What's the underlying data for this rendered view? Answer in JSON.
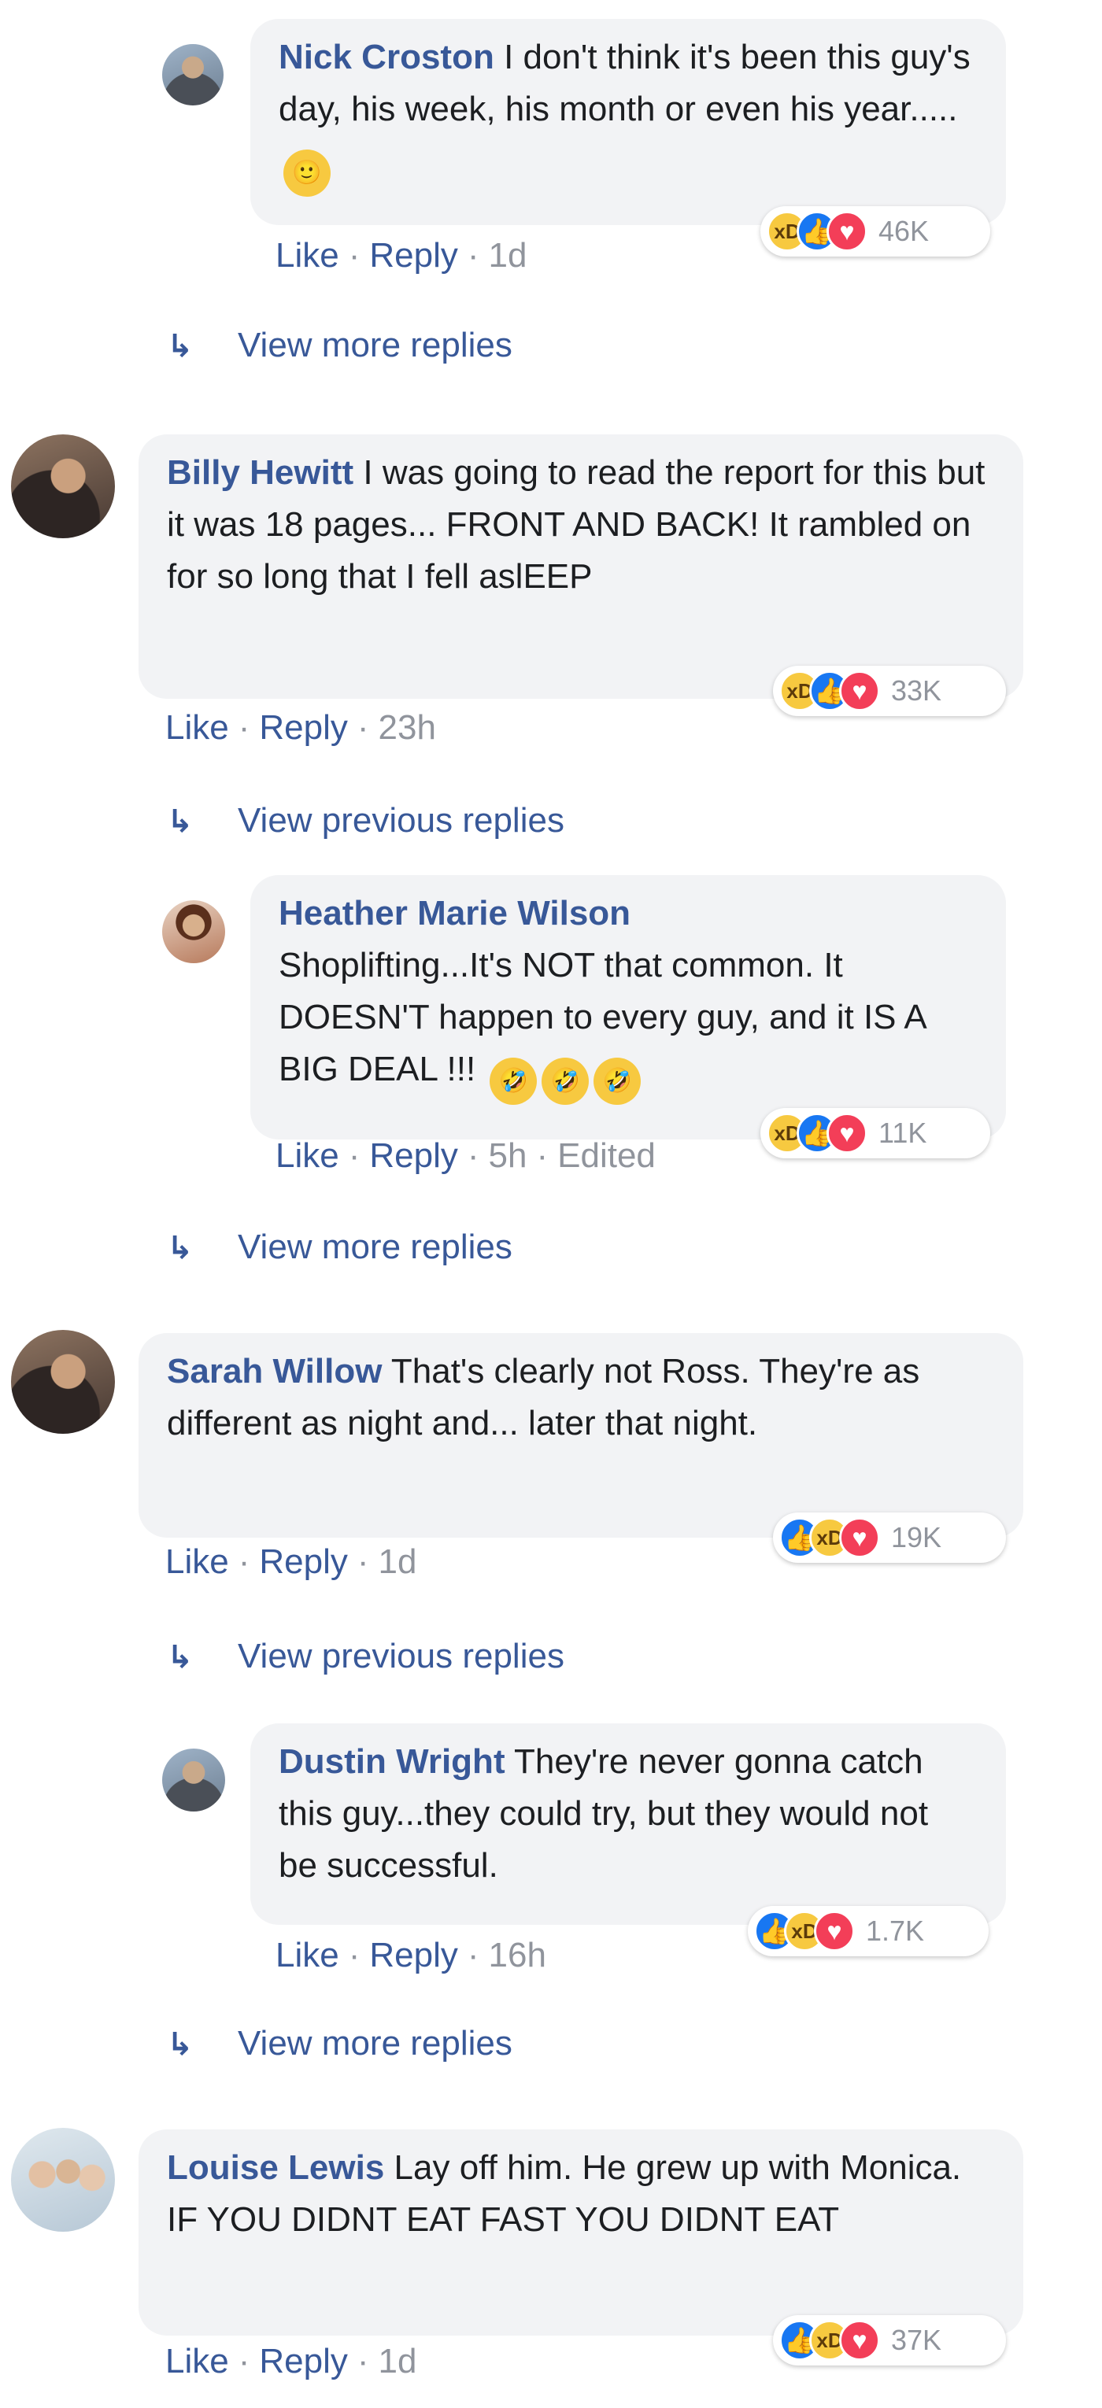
{
  "comments": [
    {
      "author": "Nick Croston",
      "text": "I don't think it's been this guy's day, his week, his month or even his year.....",
      "emoji": "🙂",
      "reactions": [
        "haha",
        "like",
        "love"
      ],
      "count": "46K",
      "like": "Like",
      "reply": "Reply",
      "time": "1d",
      "edited": "",
      "more": "View more replies"
    },
    {
      "author": "Billy Hewitt",
      "text": "I was going to read the report for this but it was 18 pages... FRONT AND BACK! It rambled on for so long that I fell aslEEP",
      "reactions": [
        "haha",
        "like",
        "love"
      ],
      "count": "33K",
      "like": "Like",
      "reply": "Reply",
      "time": "23h",
      "more": "View previous replies"
    },
    {
      "author": "Heather Marie Wilson",
      "text": "Shoplifting...It's NOT that common. It DOESN'T happen to every guy, and it IS A BIG DEAL !!!",
      "emoji": "🤣",
      "reactions": [
        "haha",
        "like",
        "love"
      ],
      "count": "11K",
      "like": "Like",
      "reply": "Reply",
      "time": "5h",
      "edited": "Edited",
      "more": "View more replies"
    },
    {
      "author": "Sarah Willow",
      "text": "That's clearly not Ross. They're as different as night and... later that night.",
      "reactions": [
        "like",
        "haha",
        "love"
      ],
      "count": "19K",
      "like": "Like",
      "reply": "Reply",
      "time": "1d",
      "more": "View previous replies"
    },
    {
      "author": "Dustin Wright",
      "text": "They're never gonna catch this guy...they could try, but they would not be successful.",
      "reactions": [
        "like",
        "haha",
        "love"
      ],
      "count": "1.7K",
      "like": "Like",
      "reply": "Reply",
      "time": "16h",
      "more": "View more replies"
    },
    {
      "author": "Louise Lewis",
      "text": "Lay off him. He grew up with Monica. IF YOU DIDNT EAT FAST YOU DIDNT EAT",
      "reactions": [
        "like",
        "haha",
        "love"
      ],
      "count": "37K",
      "like": "Like",
      "reply": "Reply",
      "time": "1d"
    }
  ],
  "colors": {
    "link": "#385898",
    "bubble": "#f2f3f5",
    "meta": "#90949c"
  }
}
